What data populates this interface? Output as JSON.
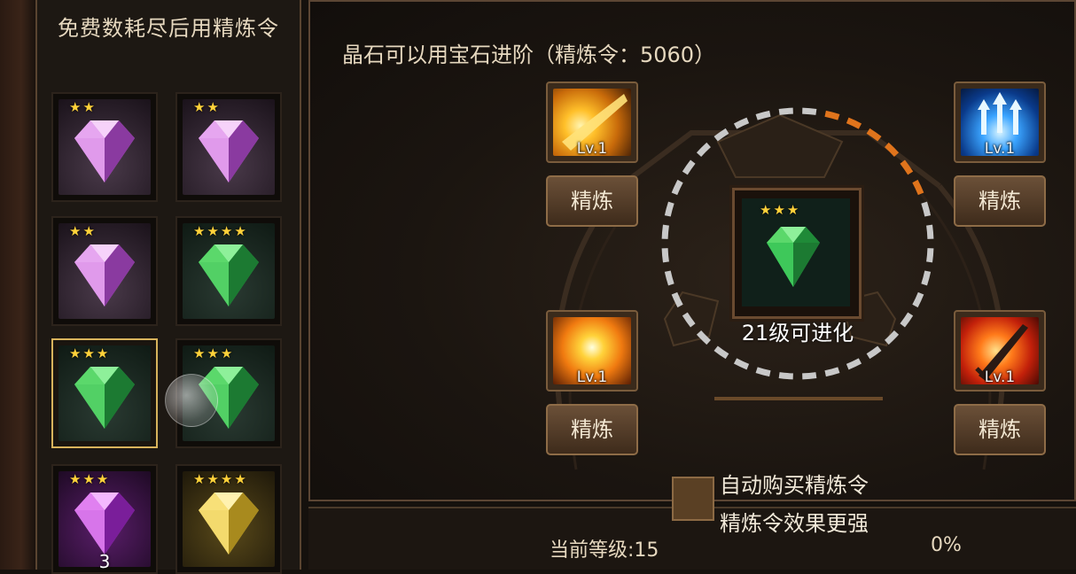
{
  "gem_panel": {
    "title": "免费数耗尽后用精炼令",
    "gems": [
      {
        "stars": "★★",
        "color": "purple",
        "count": ""
      },
      {
        "stars": "★★",
        "color": "purple",
        "count": ""
      },
      {
        "stars": "★★",
        "color": "purple",
        "count": ""
      },
      {
        "stars": "★★★★",
        "color": "green",
        "count": ""
      },
      {
        "stars": "★★★",
        "color": "green",
        "count": "",
        "selected": true
      },
      {
        "stars": "★★★",
        "color": "green",
        "count": ""
      },
      {
        "stars": "★★★",
        "color": "purple-cluster",
        "count": "3"
      },
      {
        "stars": "★★★★",
        "color": "gold-cluster",
        "count": ""
      }
    ]
  },
  "main": {
    "title": "晶石可以用宝石进阶（精炼令：5060）",
    "center": {
      "stars": "★★★",
      "evolve_text": "21级可进化"
    },
    "skills": [
      {
        "level": "Lv.1",
        "button": "精炼",
        "icon": "golden-slash-icon"
      },
      {
        "level": "Lv.1",
        "button": "精炼",
        "icon": "blue-arrows-icon"
      },
      {
        "level": "Lv.1",
        "button": "精炼",
        "icon": "explosion-icon"
      },
      {
        "level": "Lv.1",
        "button": "精炼",
        "icon": "fire-sword-icon"
      }
    ],
    "auto_buy_line1": "自动购买精炼令",
    "auto_buy_line2": "精炼令效果更强",
    "current_level": "当前等级:15",
    "progress_percent": "0%",
    "progress_value": 0.0
  },
  "colors": {
    "gold_accent": "#d8b35c",
    "progress_orange": "#e0741c",
    "progress_gray": "#c8c8c8",
    "text_cream": "#e6d8bf"
  }
}
